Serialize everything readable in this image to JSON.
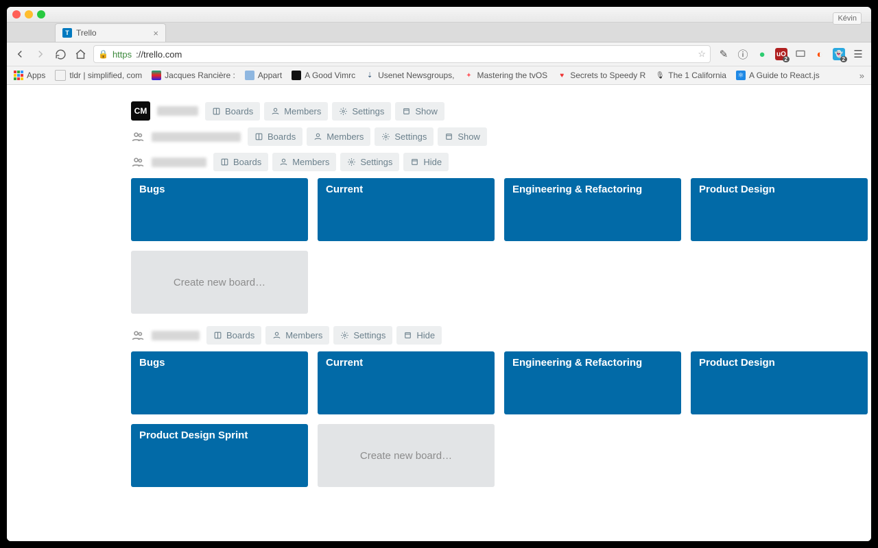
{
  "window": {
    "user_label": "Kévin"
  },
  "tab": {
    "title": "Trello"
  },
  "address": {
    "https": "https",
    "rest": "://trello.com"
  },
  "bookmarks": {
    "apps": "Apps",
    "items": [
      "tldr | simplified, com",
      "Jacques Rancière : ",
      "Appart",
      "A Good Vimrc",
      "Usenet Newsgroups,",
      "Mastering the tvOS ",
      "Secrets to Speedy R",
      "The 1 California",
      "A Guide to React.js "
    ]
  },
  "labels": {
    "boards": "Boards",
    "members": "Members",
    "settings": "Settings",
    "show": "Show",
    "hide": "Hide",
    "create_board": "Create new board…"
  },
  "teams": [
    {
      "logo_text": "CM",
      "buttons": [
        "boards",
        "members",
        "settings",
        "show"
      ],
      "boards": []
    },
    {
      "people_icon": true,
      "buttons": [
        "boards",
        "members",
        "settings",
        "show"
      ],
      "boards": []
    },
    {
      "people_icon": true,
      "buttons": [
        "boards",
        "members",
        "settings",
        "hide"
      ],
      "boards": [
        "Bugs",
        "Current",
        "Engineering & Refactoring",
        "Product Design"
      ],
      "create": true
    },
    {
      "people_icon": true,
      "buttons": [
        "boards",
        "members",
        "settings",
        "hide"
      ],
      "boards": [
        "Bugs",
        "Current",
        "Engineering & Refactoring",
        "Product Design",
        "Product Design Sprint"
      ],
      "create": true
    }
  ]
}
